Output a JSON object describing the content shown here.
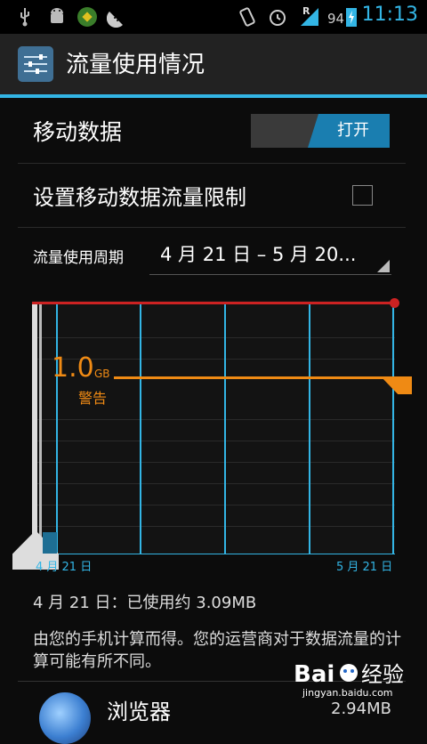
{
  "status_bar": {
    "battery": "94",
    "signal_badge": "R",
    "time": "11:13",
    "icons": [
      "usb-icon",
      "android-debug-icon",
      "app-notify-icon",
      "watermelon-icon",
      "vibrate-icon",
      "alarm-icon",
      "signal-icon",
      "battery-charging-icon"
    ]
  },
  "action_bar": {
    "title": "流量使用情况",
    "icon": "settings-sliders-icon"
  },
  "mobile_data": {
    "label": "移动数据",
    "toggle_state": "打开"
  },
  "limit_setting": {
    "label": "设置移动数据流量限制",
    "checked": false
  },
  "cycle": {
    "label": "流量使用周期",
    "value": "4 月 21 日 – 5 月 20..."
  },
  "chart": {
    "warning_value": "1.0",
    "warning_unit": "GB",
    "warning_label": "警告",
    "start_label": "4 月 21 日",
    "end_label": "5 月 21 日",
    "accent": "#33b5e5",
    "warning_color": "#ef8a14",
    "limit_color": "#cc2222"
  },
  "summary": {
    "usage": "4 月 21 日：已使用约 3.09MB",
    "note": "由您的手机计算而得。您的运营商对于数据流量的计算可能有所不同。"
  },
  "apps": [
    {
      "name": "浏览器",
      "size": "2.94MB"
    }
  ],
  "watermark": {
    "text": "jingyan.baidu.com"
  }
}
